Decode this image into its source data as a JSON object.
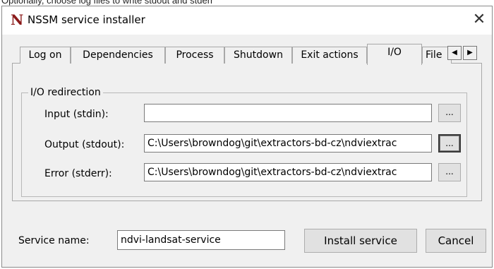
{
  "caption": "Optionally, choose log files to write stdout and stderr",
  "window": {
    "title": "NSSM service installer",
    "icon_letter": "N",
    "close_glyph": "✕"
  },
  "tabs": [
    {
      "label": "Log on"
    },
    {
      "label": "Dependencies"
    },
    {
      "label": "Process"
    },
    {
      "label": "Shutdown"
    },
    {
      "label": "Exit actions"
    },
    {
      "label": "I/O"
    },
    {
      "label": "File"
    }
  ],
  "active_tab": "I/O",
  "tab_scroll": {
    "left_glyph": "◀",
    "right_glyph": "▶"
  },
  "io_group": {
    "label": "I/O redirection",
    "rows": [
      {
        "label": "Input (stdin):",
        "value": "",
        "browse": "..."
      },
      {
        "label": "Output (stdout):",
        "value": "C:\\Users\\browndog\\git\\extractors-bd-cz\\ndviextrac",
        "browse": "..."
      },
      {
        "label": "Error (stderr):",
        "value": "C:\\Users\\browndog\\git\\extractors-bd-cz\\ndviextrac",
        "browse": "..."
      }
    ]
  },
  "service": {
    "label": "Service name:",
    "value": "ndvi-landsat-service"
  },
  "buttons": {
    "install": "Install service",
    "cancel": "Cancel"
  }
}
